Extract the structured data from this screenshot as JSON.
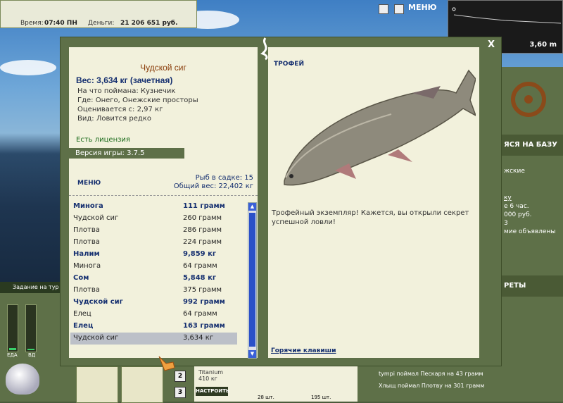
{
  "topbar": {
    "time_label": "Время:",
    "time_value": "07:40 ПН",
    "money_label": "Деньги:",
    "money_value": "21 206 651 руб."
  },
  "menu_top_label": "МЕНЮ",
  "depth": {
    "value": "3,60 m"
  },
  "dialog": {
    "close_label": "X",
    "fish_name": "Чудской сиг",
    "weight_line": "Вес: 3,634 кг (зачетная)",
    "info": [
      "На что поймана: Кузнечик",
      "Где: Онего, Онежские просторы",
      "Оценивается с: 2,97 кг",
      "Вид: Ловится редко"
    ],
    "license": "Есть лицензия",
    "version": "Версия игры: 3.7.5",
    "menu_label": "МЕНЮ",
    "keepnet_count": "Рыб в садке: 15",
    "keepnet_weight": "Общий вес: 22,402 кг",
    "trophy_label": "ТРОФЕЙ",
    "description": "Трофейный экземпляр! Кажется, вы открыли секрет успешной ловли!",
    "hotkeys": "Горячие клавиши"
  },
  "fish_list": [
    {
      "name": "Минога",
      "weight": "111 грамм",
      "bold": true
    },
    {
      "name": "Чудской сиг",
      "weight": "260 грамм",
      "bold": false
    },
    {
      "name": "Плотва",
      "weight": "286 грамм",
      "bold": false
    },
    {
      "name": "Плотва",
      "weight": "224 грамм",
      "bold": false
    },
    {
      "name": "Налим",
      "weight": "9,859 кг",
      "bold": true
    },
    {
      "name": "Минога",
      "weight": "64 грамм",
      "bold": false
    },
    {
      "name": "Сом",
      "weight": "5,848 кг",
      "bold": true
    },
    {
      "name": "Плотва",
      "weight": "375 грамм",
      "bold": false
    },
    {
      "name": "Чудской сиг",
      "weight": "992 грамм",
      "bold": true
    },
    {
      "name": "Елец",
      "weight": "64 грамм",
      "bold": false
    },
    {
      "name": "Елец",
      "weight": "163 грамм",
      "bold": true
    },
    {
      "name": "Чудской сиг",
      "weight": "3,634 кг",
      "bold": false,
      "selected": true
    }
  ],
  "right_panel": {
    "base_label": "ЯСЯ НА БАЗУ",
    "line1": "жские",
    "line2": "ку",
    "line3": "е 6 час.",
    "line4": "000 руб.",
    "line5": "3",
    "line6": "мие объявлены",
    "secrets_label": "РЕТЫ"
  },
  "task_bar": "Задание на тур",
  "gauges": {
    "food_label": "ЕДА",
    "drink_label": "ВД",
    "food_level": 0.05,
    "drink_level": 0.04
  },
  "tackle": {
    "name": "Titanium",
    "weight": "410 кг",
    "setup_label": "НАСТРОИТЬ",
    "count1": "28 шт.",
    "count2": "195 шт."
  },
  "slots": [
    "2",
    "3"
  ],
  "messages": [
    "tympi поймал Пескаря на 43 грамм",
    "Хлыщ поймал Плотву на 301 грамм"
  ]
}
